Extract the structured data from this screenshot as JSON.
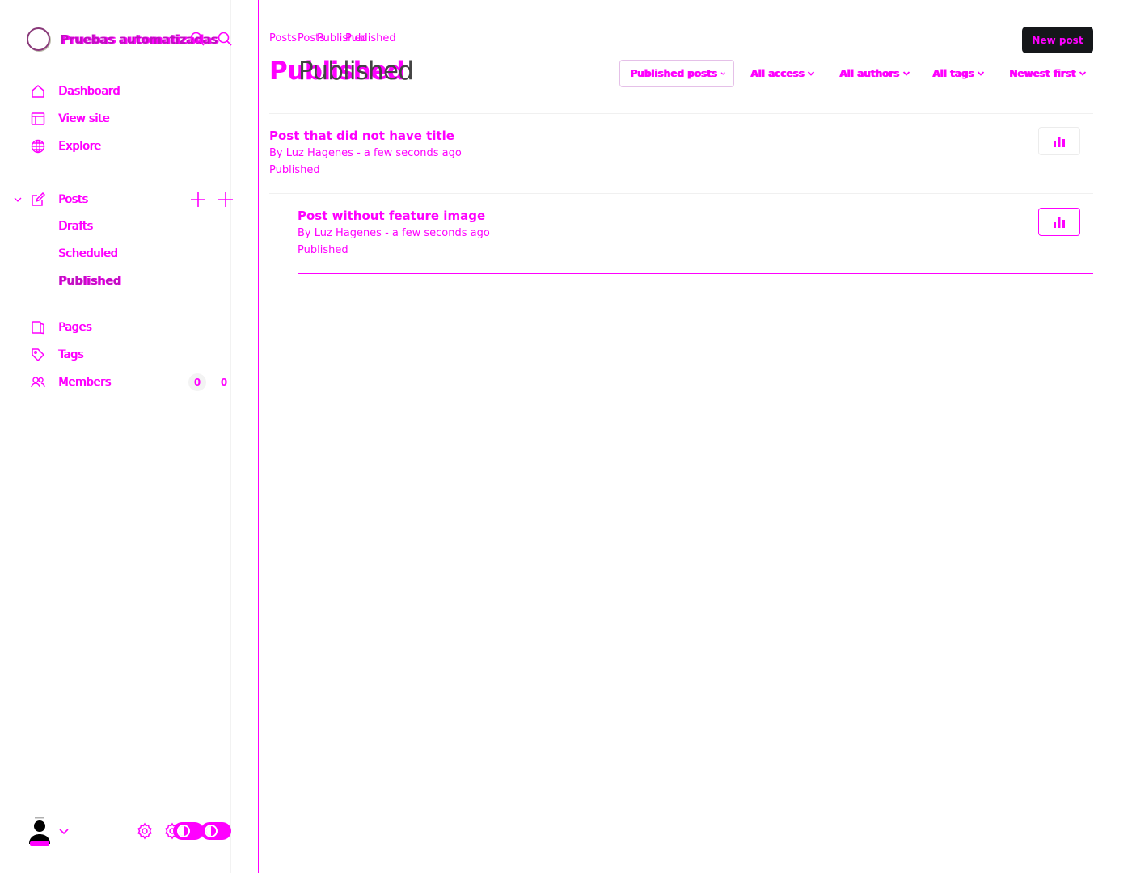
{
  "sidebar": {
    "site_name": "Pruebas automatizadas",
    "nav": {
      "dashboard": "Dashboard",
      "view_site": "View site",
      "explore": "Explore",
      "posts": "Posts",
      "drafts": "Drafts",
      "scheduled": "Scheduled",
      "published": "Published",
      "pages": "Pages",
      "tags": "Tags",
      "members": "Members",
      "members_count": "0"
    }
  },
  "header": {
    "breadcrumb_parent": "Posts",
    "breadcrumb_current": "Published",
    "title": "Published",
    "new_post_label": "New post"
  },
  "filters": {
    "type": "Published posts",
    "access": "All access",
    "authors": "All authors",
    "tags": "All tags",
    "order": "Newest first"
  },
  "posts": [
    {
      "title": "Post that did not have title",
      "meta": "By Luz Hagenes - a few seconds ago",
      "status": "Published"
    },
    {
      "title": "Post without feature image",
      "meta": "By Luz Hagenes - a few seconds ago",
      "status": "Published"
    }
  ],
  "colors": {
    "accent": "#ff00ff",
    "button_dark": "#15171a"
  }
}
